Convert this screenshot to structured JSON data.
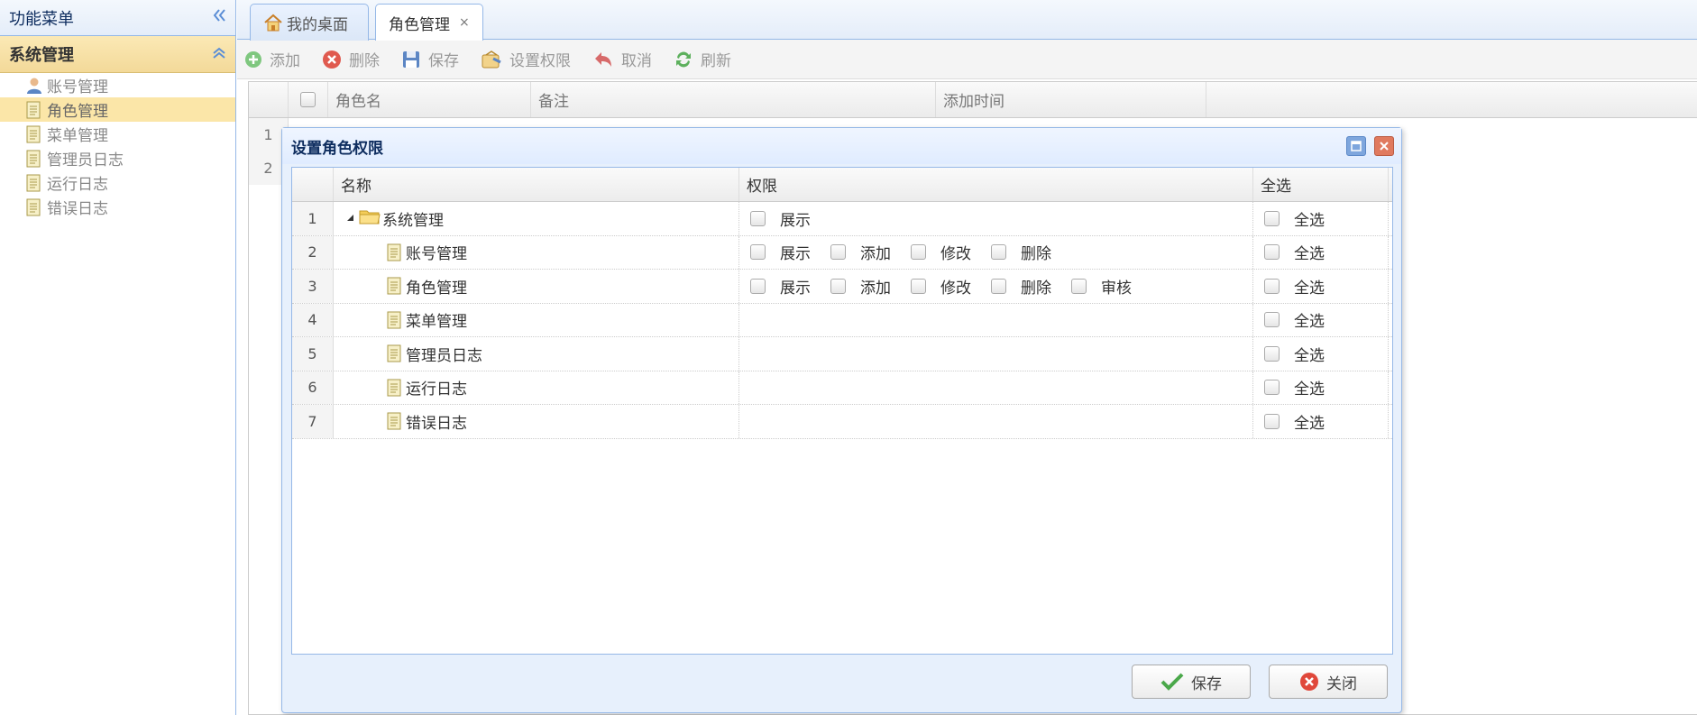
{
  "sidebar": {
    "title": "功能菜单",
    "section": "系统管理",
    "items": [
      {
        "label": "账号管理",
        "icon": "user-icon"
      },
      {
        "label": "角色管理",
        "icon": "document-icon"
      },
      {
        "label": "菜单管理",
        "icon": "document-icon"
      },
      {
        "label": "管理员日志",
        "icon": "document-icon"
      },
      {
        "label": "运行日志",
        "icon": "document-icon"
      },
      {
        "label": "错误日志",
        "icon": "document-icon"
      }
    ]
  },
  "tabs": [
    {
      "label": "我的桌面",
      "icon": "home-icon"
    },
    {
      "label": "角色管理",
      "close": "×"
    }
  ],
  "toolbar": {
    "add": "添加",
    "delete": "删除",
    "save": "保存",
    "permissions": "设置权限",
    "cancel": "取消",
    "refresh": "刷新"
  },
  "grid": {
    "columns": [
      "角色名",
      "备注",
      "添加时间"
    ],
    "row_numbers": [
      "1",
      "2"
    ]
  },
  "dialog": {
    "title": "设置角色权限",
    "columns": {
      "name": "名称",
      "permission": "权限",
      "select_all": "全选"
    },
    "rows": [
      {
        "num": "1",
        "name": "系统管理",
        "perms": [
          "展示"
        ],
        "all": "全选"
      },
      {
        "num": "2",
        "name": "账号管理",
        "perms": [
          "展示",
          "添加",
          "修改",
          "删除"
        ],
        "all": "全选"
      },
      {
        "num": "3",
        "name": "角色管理",
        "perms": [
          "展示",
          "添加",
          "修改",
          "删除",
          "审核"
        ],
        "all": "全选"
      },
      {
        "num": "4",
        "name": "菜单管理",
        "perms": [],
        "all": "全选"
      },
      {
        "num": "5",
        "name": "管理员日志",
        "perms": [],
        "all": "全选"
      },
      {
        "num": "6",
        "name": "运行日志",
        "perms": [],
        "all": "全选"
      },
      {
        "num": "7",
        "name": "错误日志",
        "perms": [],
        "all": "全选"
      }
    ],
    "save": "保存",
    "close": "关闭"
  }
}
